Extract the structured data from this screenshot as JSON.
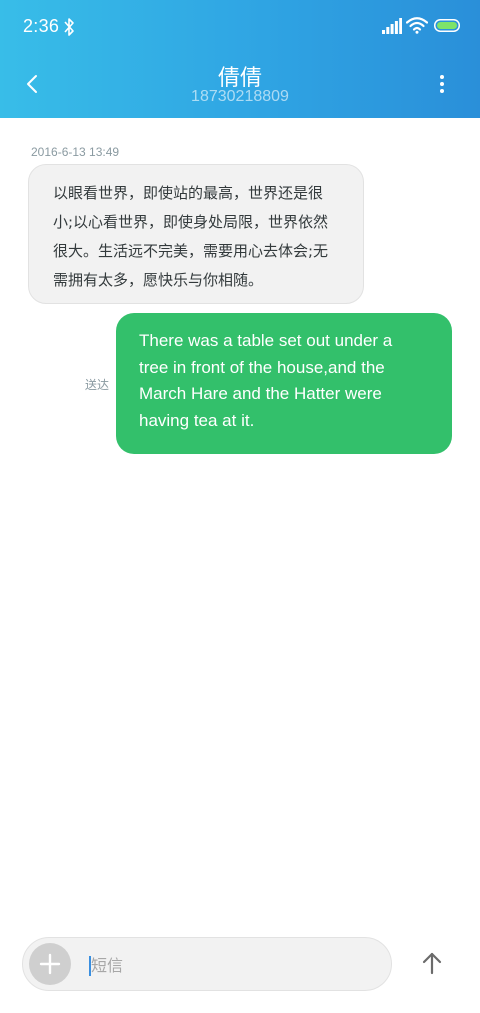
{
  "status_bar": {
    "time": "2:36",
    "icons": [
      "bluetooth-icon",
      "signal-icon",
      "wifi-icon",
      "battery-icon"
    ]
  },
  "header": {
    "contact_name": "倩倩",
    "contact_number": "18730218809",
    "back_icon": "chevron-left-icon",
    "more_icon": "more-vertical-icon"
  },
  "conversation": {
    "timestamp": "2016-6-13 13:49",
    "messages": [
      {
        "direction": "incoming",
        "text": "以眼看世界，即使站的最高，世界还是很小;以心看世界，即使身处局限，世界依然很大。生活远不完美，需要用心去体会;无需拥有太多，愿快乐与你相随。"
      },
      {
        "direction": "outgoing",
        "text": "There was a table set out under a tree in front of the house,and the March Hare and the Hatter were having tea at it.",
        "status": "送达"
      }
    ]
  },
  "compose": {
    "placeholder": "短信",
    "value": "",
    "attach_icon": "plus-icon",
    "send_icon": "arrow-up-icon"
  },
  "colors": {
    "header_gradient_start": "#38bde8",
    "header_gradient_end": "#2a8fd9",
    "outgoing_bubble": "#33c06b",
    "incoming_bubble": "#f2f2f2",
    "meta_text": "#8a9aa1"
  }
}
